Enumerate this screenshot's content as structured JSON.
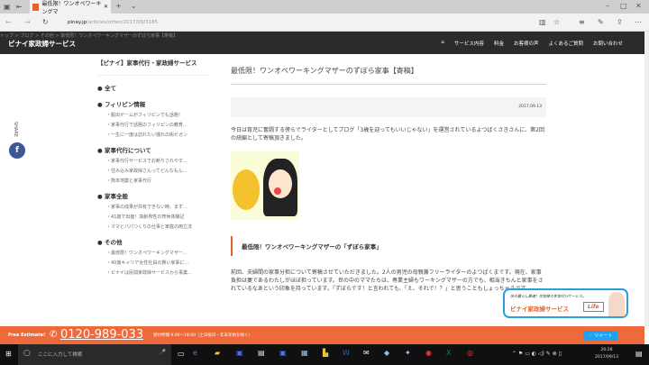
{
  "browser": {
    "tab_title": "最低限！ワンオペワーキングマ",
    "url_host": "pinay.jp",
    "url_path": "/articles/other/2017/09/3185"
  },
  "site": {
    "brand": "ピナイ家政婦サービス",
    "breadcrumb": "トップ > ブログ > その他 > 最低限！ワンオペワーキングマザーのずぼら家事【寄稿】",
    "nav": [
      "サービス内容",
      "料金",
      "お客様の声",
      "よくあるご質問",
      "お問い合わせ"
    ]
  },
  "sidebar": {
    "title": "【ピナイ】家事代行・家政婦サービス",
    "categories": [
      {
        "label": "全て",
        "items": []
      },
      {
        "label": "フィリピン情報",
        "items": [
          "脱出ゲームがフィリピンでも話題！",
          "家事代行で話題のフィリピンの教育...",
          "一生に一度は訪れたい憧れの街ビガン"
        ]
      },
      {
        "label": "家事代行について",
        "items": [
          "家事代行サービスでお断りされやす...",
          "住み込み家政婦さんってどんなもん...",
          "熊本地震と家事代行"
        ]
      },
      {
        "label": "家事全般",
        "items": [
          "家事の成果が共有できない時、まず...",
          "41歳で出産！高齢男性の育休体験記",
          "ママとパパつくりの仕事と家庭の両立法"
        ]
      },
      {
        "label": "その他",
        "items": [
          "最低限！ワンオペワーキングマザー...",
          "40歳キャリア女性社員の賢い家事に...",
          "ピナイは民間家政婦サービスから事業..."
        ]
      }
    ]
  },
  "share": {
    "label": "SHARE",
    "icon": "facebook-icon"
  },
  "article": {
    "title": "最低限！ワンオペワーキングマザーのずぼら家事【寄稿】",
    "date": "2017.09.13",
    "intro": "今日は育児に奮闘する傍らでライターとしてブログ「3歳を迎ってもいいじゃない」を運営されているよつばくさきさんに、第2回の続編として寄稿頂きました。",
    "heading": "最低限！ワンオペワーキングマザーの「ずぼら家事」",
    "body": "前回、夫婦間の家事分担について寄稿させていただきました。2人の男児の母親兼フリーライターのよつばくまです。現在、家事負担は妻であるわたしがほぼ担っています。世の中のママたちは、専業主婦もワーキングマザーの方でも、相当きちんと家事をされているなあという印象を持っています。「ずぼらです！と言われても、「え、それで！？」と思うこともしょっちゅうです。"
  },
  "banner": {
    "tagline": "余の暮らし最適！住居様々家事代行サービス。",
    "brand": "ピナイ家政婦サービス",
    "badge": "Life"
  },
  "footer": {
    "free": "Free Estimate!",
    "phone": "0120-989-033",
    "hours": "受付時間 9:00～18:00（土日祝日・年末年始を除く）",
    "tweet": "ツイート"
  },
  "taskbar": {
    "search": "ここに入力して検索",
    "time": "20:28",
    "date": "2017/09/13"
  }
}
